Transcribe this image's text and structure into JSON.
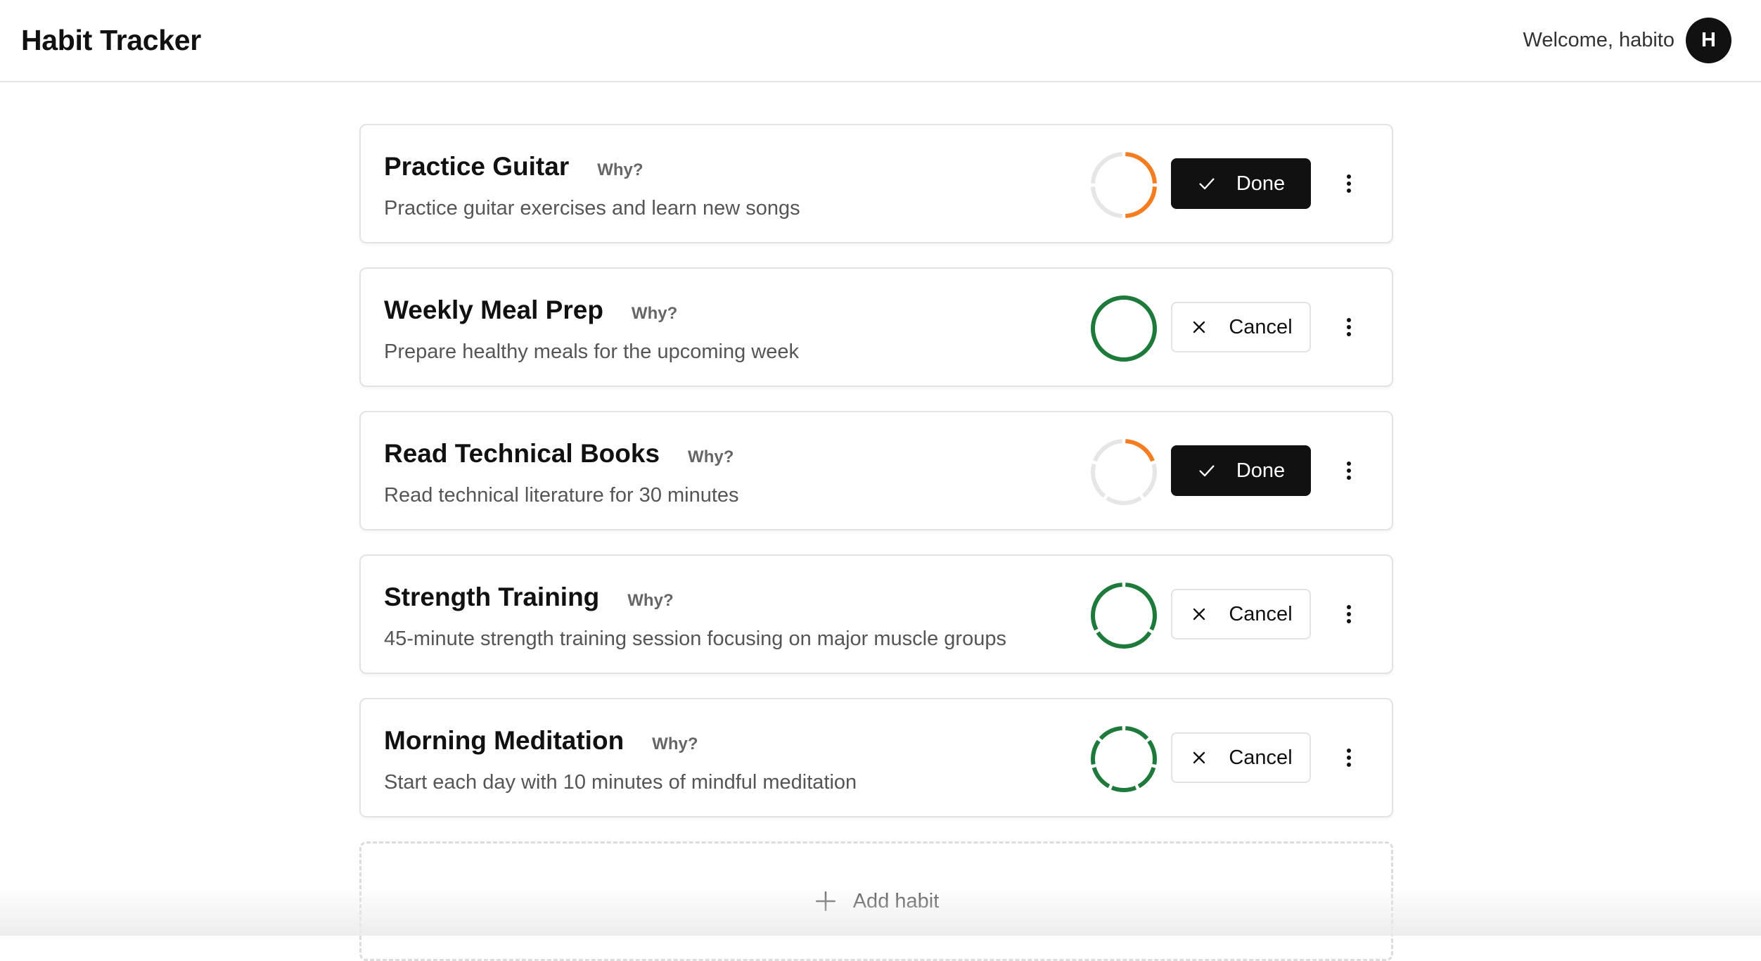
{
  "header": {
    "app_title": "Habit Tracker",
    "welcome_text": "Welcome, habito",
    "avatar_initial": "H"
  },
  "colors": {
    "ring_track": "#e6e6e6",
    "progress_partial": "#f57c1f",
    "progress_complete": "#1d7a3a",
    "primary_button": "#111111"
  },
  "habits": [
    {
      "title": "Practice Guitar",
      "why_label": "Why?",
      "description": "Practice guitar exercises and learn new songs",
      "button_label": "Done",
      "button_type": "done",
      "progress_segments": 4,
      "completed_segments": 2,
      "ring_color": "#f57c1f"
    },
    {
      "title": "Weekly Meal Prep",
      "why_label": "Why?",
      "description": "Prepare healthy meals for the upcoming week",
      "button_label": "Cancel",
      "button_type": "cancel",
      "progress_segments": 1,
      "completed_segments": 1,
      "ring_color": "#1d7a3a"
    },
    {
      "title": "Read Technical Books",
      "why_label": "Why?",
      "description": "Read technical literature for 30 minutes",
      "button_label": "Done",
      "button_type": "done",
      "progress_segments": 5,
      "completed_segments": 1,
      "ring_color": "#f57c1f"
    },
    {
      "title": "Strength Training",
      "why_label": "Why?",
      "description": "45-minute strength training session focusing on major muscle groups",
      "button_label": "Cancel",
      "button_type": "cancel",
      "progress_segments": 3,
      "completed_segments": 3,
      "ring_color": "#1d7a3a"
    },
    {
      "title": "Morning Meditation",
      "why_label": "Why?",
      "description": "Start each day with 10 minutes of mindful meditation",
      "button_label": "Cancel",
      "button_type": "cancel",
      "progress_segments": 7,
      "completed_segments": 7,
      "ring_color": "#1d7a3a"
    }
  ],
  "add_habit": {
    "label": "Add habit"
  }
}
